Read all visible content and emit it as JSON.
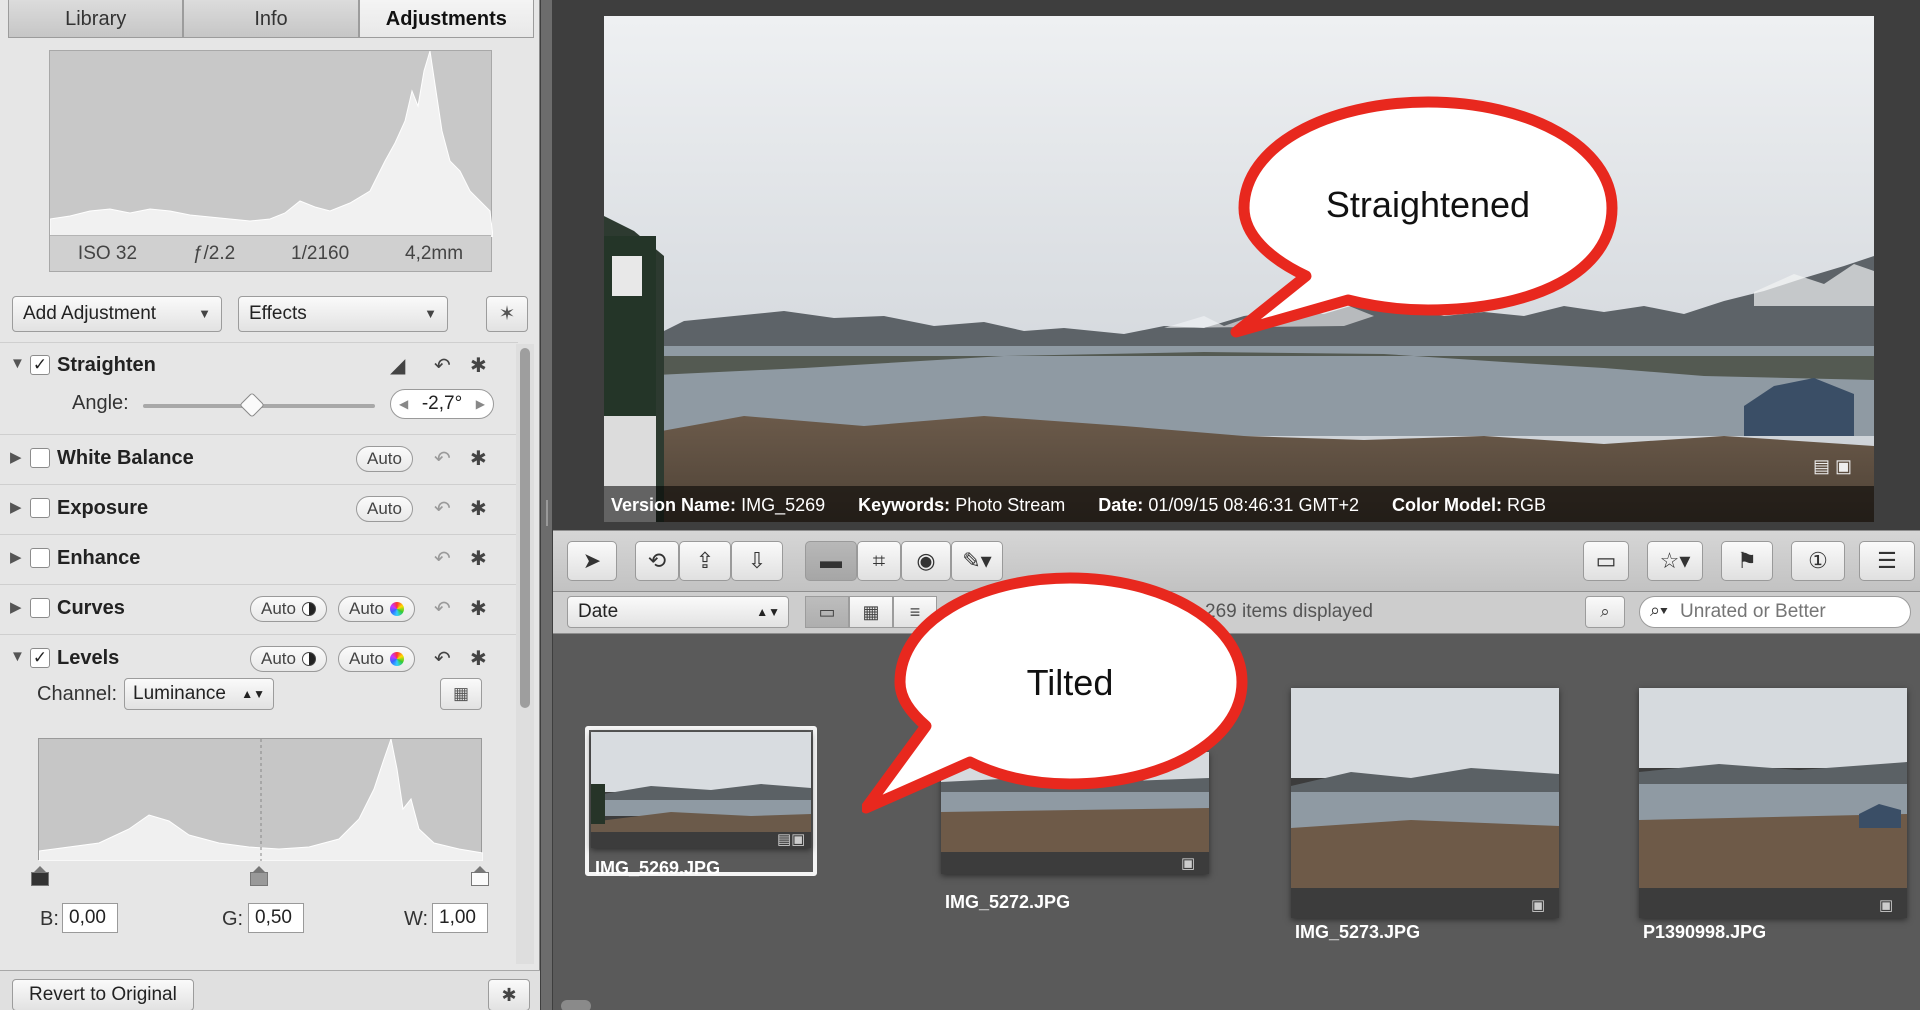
{
  "tabs": [
    "Library",
    "Info",
    "Adjustments"
  ],
  "histogram": {
    "iso": "ISO 32",
    "aperture": "ƒ/2.2",
    "shutter": "1/2160",
    "focal": "4,2mm"
  },
  "add_adjustment": "Add Adjustment",
  "effects": "Effects",
  "adjustments": {
    "straighten": {
      "label": "Straighten",
      "checked": true,
      "angle_label": "Angle:",
      "angle_value": "-2,7°"
    },
    "white_balance": {
      "label": "White Balance",
      "auto": "Auto"
    },
    "exposure": {
      "label": "Exposure",
      "auto": "Auto"
    },
    "enhance": {
      "label": "Enhance"
    },
    "curves": {
      "label": "Curves",
      "auto_bw": "Auto",
      "auto_color": "Auto"
    },
    "levels": {
      "label": "Levels",
      "checked": true,
      "auto_bw": "Auto",
      "auto_color": "Auto",
      "channel_label": "Channel:",
      "channel_value": "Luminance",
      "b_label": "B:",
      "b_value": "0,00",
      "g_label": "G:",
      "g_value": "0,50",
      "w_label": "W:",
      "w_value": "1,00"
    }
  },
  "revert_button": "Revert to Original",
  "viewer": {
    "version_name_label": "Version Name:",
    "version_name": "IMG_5269",
    "keywords_label": "Keywords:",
    "keywords": "Photo Stream",
    "date_label": "Date:",
    "date": "01/09/15 08:46:31 GMT+2",
    "color_model_label": "Color Model:",
    "color_model": "RGB"
  },
  "browser": {
    "sort": "Date",
    "items_displayed": "269 items displayed",
    "search_placeholder": "Unrated or Better",
    "thumbnails": [
      "IMG_5269.JPG",
      "IMG_5272.JPG",
      "IMG_5273.JPG",
      "P1390998.JPG"
    ]
  },
  "callouts": {
    "straightened": "Straightened",
    "tilted": "Tilted"
  },
  "colors": {
    "callout_border": "#e8281e",
    "sky": "#d8dce0",
    "water": "#8e9aa4",
    "land": "#6e5a48"
  }
}
